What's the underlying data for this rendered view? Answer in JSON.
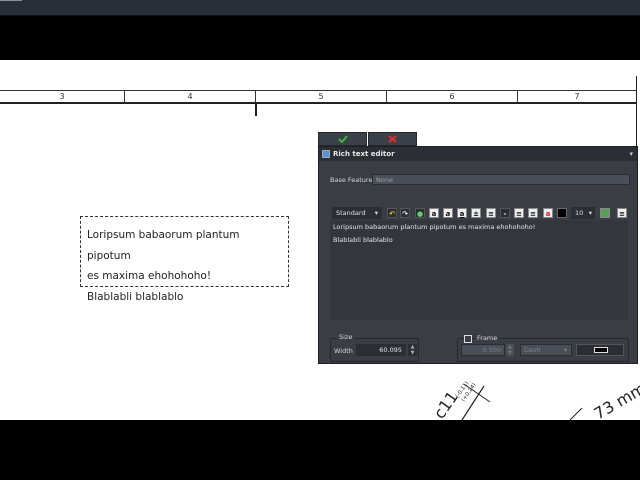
{
  "ruler": {
    "labels": [
      "3",
      "4",
      "5",
      "6",
      "7"
    ]
  },
  "canvas_text": {
    "line1": "Loripsum babaorum plantum pipotum",
    "line2": "es maxima ehohohoho!",
    "line3": "Blablabli blablablo"
  },
  "dimensions": {
    "annotation1": "c11",
    "tol_upper": "(-0.11)",
    "tol_lower": "(+0.24)",
    "annotation2": "73 mm"
  },
  "actions": {
    "ok_icon": "check-icon",
    "cancel_icon": "x-icon",
    "ok_color": "#3cba3c",
    "cancel_color": "#e0302a"
  },
  "panel": {
    "title": "Rich text editor",
    "base_feature_label": "Base Feature",
    "base_feature_value": "None",
    "style_value": "Standard",
    "font_size_value": "10",
    "editor_line1": "Loripsum babaorum plantum pipotum es maxima ehohohoho!",
    "editor_line2": "Blablabli blablablo",
    "size_group_label": "Size",
    "width_label": "Width",
    "width_value": "60.095",
    "frame_label": "Frame",
    "frame_value": "0.500",
    "frame_style": "Dash"
  }
}
